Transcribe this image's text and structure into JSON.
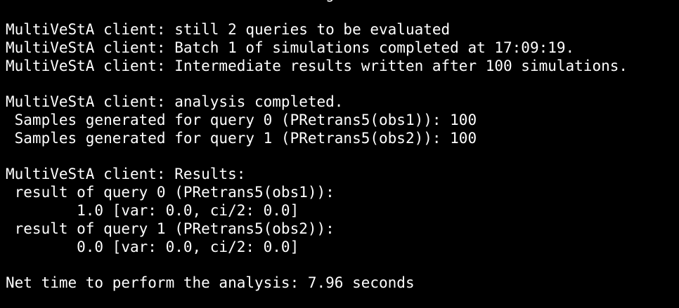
{
  "terminal": {
    "clipped_top_line": "g",
    "lines": [
      "MultiVeStA client: still 2 queries to be evaluated",
      "MultiVeStA client: Batch 1 of simulations completed at 17:09:19.",
      "MultiVeStA client: Intermediate results written after 100 simulations.",
      "",
      "MultiVeStA client: analysis completed.",
      " Samples generated for query 0 (PRetrans5(obs1)): 100",
      " Samples generated for query 1 (PRetrans5(obs2)): 100",
      "",
      "MultiVeStA client: Results:",
      " result of query 0 (PRetrans5(obs1)):",
      "        1.0 [var: 0.0, ci/2: 0.0]",
      " result of query 1 (PRetrans5(obs2)):",
      "        0.0 [var: 0.0, ci/2: 0.0]",
      "",
      "Net time to perform the analysis: 7.96 seconds"
    ],
    "colors": {
      "background": "#000000",
      "text": "#ffffff"
    }
  }
}
